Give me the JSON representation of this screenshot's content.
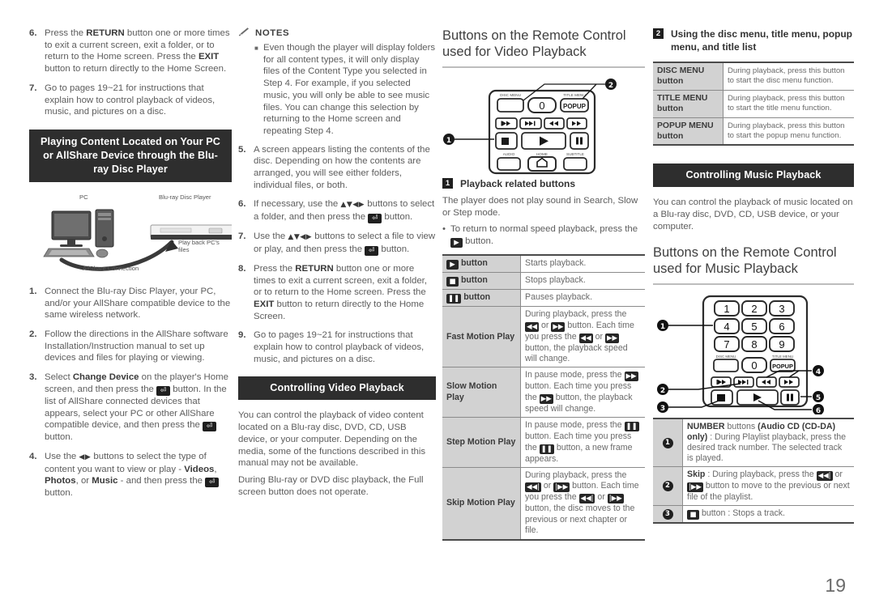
{
  "page_number": "19",
  "column1": {
    "steps_top": [
      {
        "num": "6.",
        "html": "Press the <b>RETURN</b> button one or more times to exit a current screen, exit a folder, or to return to the Home screen. Press the <b>EXIT</b> button to return directly to the Home Screen."
      },
      {
        "num": "7.",
        "html": "Go to pages 19~21 for instructions that explain how to control playback of videos, music, and pictures on a disc."
      }
    ],
    "banner": "Playing Content Located on Your PC or AllShare Device through the Blu-ray Disc Player",
    "diagram": {
      "pc_label": "PC",
      "player_label": "Blu-ray Disc Player",
      "playback_label": "Play back PC's files",
      "connection_label": "AllShare Connection"
    },
    "steps_bottom": [
      {
        "num": "1.",
        "html": "Connect the Blu-ray Disc Player, your PC, and/or your AllShare compatible device to the same wireless network."
      },
      {
        "num": "2.",
        "html": "Follow the directions in the AllShare software Installation/Instruction manual to set up devices and files for playing or viewing."
      },
      {
        "num": "3.",
        "html": "Select <b>Change Device</b> on the player's Home screen, and then press the <span class=\"key enter\">&#9166;</span> button. In the list of AllShare connected devices that appears, select your PC or other AllShare compatible device, and then press the <span class=\"key enter\">&#9166;</span> button."
      },
      {
        "num": "4.",
        "html": "Use the <span class=\"arrows\">&#9664;&#9654;</span> buttons to select the type of content you want to view or play - <b>Videos</b>, <b>Photos</b>, or <b>Music</b> - and then press the <span class=\"key enter\">&#9166;</span> button."
      }
    ]
  },
  "column2": {
    "notes_title": "NOTES",
    "notes": [
      "Even though the player will display folders for all content types, it will only display files of the Content Type you selected in Step 4. For example, if you selected music, you will only be able to see music files. You can change this selection by returning to the Home screen and repeating Step 4."
    ],
    "steps": [
      {
        "num": "5.",
        "html": "A screen appears listing the contents of the disc. Depending on how the contents are arranged, you will see either folders, individual files, or both."
      },
      {
        "num": "6.",
        "html": "If necessary, use the <span class=\"arrows\">&#9650;&#9660;&#9664;&#9654;</span> buttons to select a folder, and then press the <span class=\"key enter\">&#9166;</span> button."
      },
      {
        "num": "7.",
        "html": "Use the <span class=\"arrows\">&#9650;&#9660;&#9664;&#9654;</span> buttons to select a file to view or play, and then press the <span class=\"key enter\">&#9166;</span> button."
      },
      {
        "num": "8.",
        "html": "Press the <b>RETURN</b> button one or more times to exit a current screen, exit a folder, or to return to the Home screen. Press the <b>EXIT</b> button to return directly to the Home Screen."
      },
      {
        "num": "9.",
        "html": "Go to pages 19~21 for instructions that explain how to control playback of videos, music, and pictures on a disc."
      }
    ],
    "banner": "Controlling Video Playback",
    "paragraphs": [
      "You can control the playback of video content located on a Blu-ray disc, DVD, CD, USB device, or your computer. Depending on the media, some of the functions described in this manual may not be available.",
      "During Blu-ray or DVD disc playback, the Full screen button does not operate."
    ]
  },
  "column3": {
    "heading": "Buttons on the Remote Control used for Video Playback",
    "remote_labels": {
      "disc_menu": "DISC MENU",
      "title_menu": "TITLE MENU",
      "popup": "POPUP",
      "zero": "0",
      "audio": "AUDIO",
      "home": "HOME",
      "subtitle": "SUBTITLE",
      "callout1": "1",
      "callout2": "2"
    },
    "subhead_badge": "1",
    "subhead": "Playback related buttons",
    "intro": "The player does not play sound in Search, Slow or Step mode.",
    "dot_note": "To return to normal speed playback, press the <span class=\"key\">&#9654;</span> button.",
    "table": [
      {
        "label": "<span class=\"key\">&#9654;</span> button",
        "label_bold": true,
        "value": "Starts playback."
      },
      {
        "label": "<span class=\"key\">&#9632;</span> button",
        "label_bold": true,
        "value": "Stops playback."
      },
      {
        "label": "<span class=\"key\">&#10074;&#10074;</span> button",
        "label_bold": true,
        "value": "Pauses playback."
      },
      {
        "label": "Fast Motion Play",
        "label_bold": true,
        "value": "During playback, press the <span class=\"key\">&#9664;&#9664;</span> or <span class=\"key\">&#9654;&#9654;</span> button. Each time you press the <span class=\"key\">&#9664;&#9664;</span> or <span class=\"key\">&#9654;&#9654;</span> button, the playback speed will change."
      },
      {
        "label": "Slow Motion Play",
        "label_bold": true,
        "value": "In pause mode, press the <span class=\"key\">&#9654;&#9654;</span> button. Each time you press the <span class=\"key\">&#9654;&#9654;</span> button, the playback speed will change."
      },
      {
        "label": "Step Motion Play",
        "label_bold": true,
        "value": "In pause mode, press the <span class=\"key\">&#10074;&#10074;</span> button. Each time you press the <span class=\"key\">&#10074;&#10074;</span> button, a new frame appears."
      },
      {
        "label": "Skip Motion Play",
        "label_bold": true,
        "value": "During playback, press the <span class=\"key\">&#9664;&#9664;|</span> or <span class=\"key\">|&#9654;&#9654;</span> button. Each time you press the <span class=\"key\">&#9664;&#9664;|</span> or <span class=\"key\">|&#9654;&#9654;</span> button, the disc moves to the previous or next chapter or file."
      }
    ]
  },
  "column4": {
    "subhead_badge": "2",
    "subhead": "Using the disc menu, title menu, popup menu, and title list",
    "menu_table": [
      {
        "label": "DISC MENU button",
        "value": "During playback, press this button to start the disc menu function."
      },
      {
        "label": "TITLE MENU button",
        "value": "During playback, press this button to start the title menu function."
      },
      {
        "label": "POPUP MENU button",
        "value": "During playback, press this button to start the popup menu function."
      }
    ],
    "banner": "Controlling Music Playback",
    "paragraph": "You can control the playback of music located on a Blu-ray disc, DVD, CD, USB device, or your computer.",
    "heading": "Buttons on the Remote Control used for Music Playback",
    "remote_labels": {
      "keys": [
        "1",
        "2",
        "3",
        "4",
        "5",
        "6",
        "7",
        "8",
        "9"
      ],
      "zero": "0",
      "popup": "POPUP",
      "disc_menu": "DISC MENU",
      "title_menu": "TITLE MENU",
      "callouts": [
        "1",
        "2",
        "3",
        "4",
        "5",
        "6"
      ]
    },
    "number_table": [
      {
        "idx": "1",
        "value": "<b>NUMBER</b> buttons <b>(Audio CD (CD-DA) only)</b> : During Playlist playback, press the desired track number. The selected track is played."
      },
      {
        "idx": "2",
        "value": "<b>Skip</b> : During playback, press the <span class=\"key\">&#9664;&#9664;|</span> or <span class=\"key\">|&#9654;&#9654;</span> button to move to the previous or next file of the playlist."
      },
      {
        "idx": "3",
        "value": "<span class=\"key\">&#9632;</span> button : Stops a track."
      }
    ]
  },
  "colors": {
    "banner_bg": "#2e2e2e",
    "body_text": "#5d5d5d",
    "table_header_bg": "#d2d2d2",
    "rule": "#bdbdbd"
  }
}
